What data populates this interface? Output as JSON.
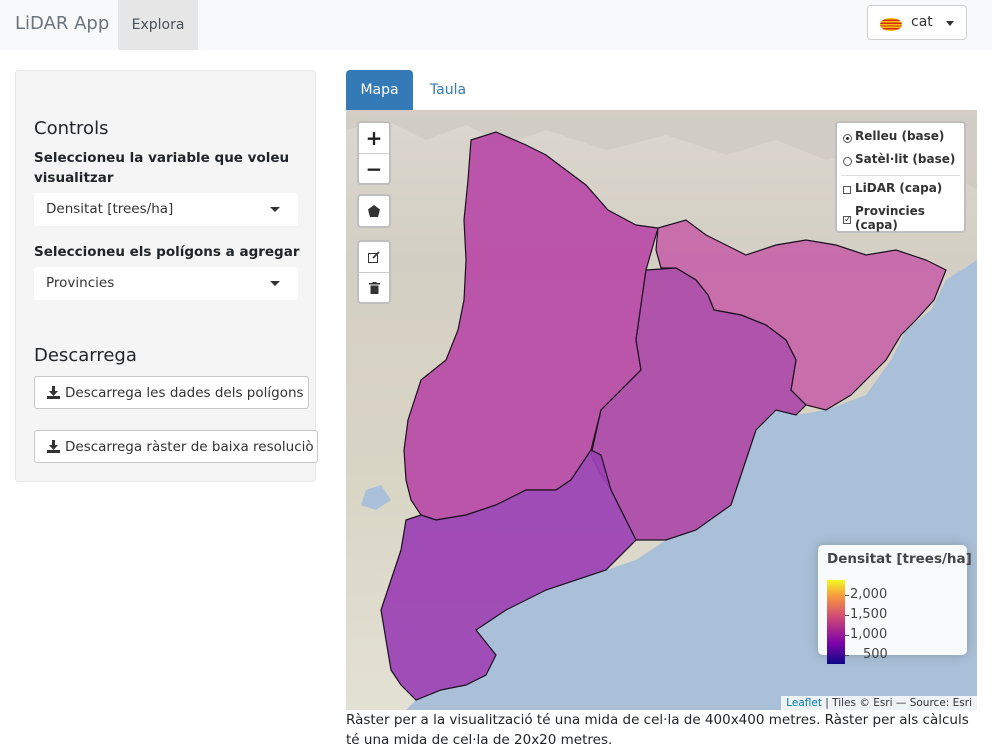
{
  "navbar": {
    "brand": "LiDAR App",
    "tab": "Explora",
    "language": "cat"
  },
  "sidebar": {
    "controls_heading": "Controls",
    "variable_label": "Seleccioneu la variable que voleu visualitzar",
    "variable_value": "Densitat [trees/ha]",
    "polygons_label": "Seleccioneu els polígons a agregar",
    "polygons_value": "Provincies",
    "download_heading": "Descarrega",
    "download_polygons": "Descarrega les dades dels polígons",
    "download_raster": "Descarrega ràster de baixa resoluciò"
  },
  "tabs": [
    "Mapa",
    "Taula"
  ],
  "map": {
    "zoom_in": "+",
    "zoom_out": "−",
    "layers": {
      "base": [
        {
          "label": "Relleu (base)",
          "selected": true
        },
        {
          "label": "Satèl·lit (base)",
          "selected": false
        }
      ],
      "overlays": [
        {
          "label": "LiDAR (capa)",
          "checked": false
        },
        {
          "label": "Provincies (capa)",
          "checked": true
        }
      ]
    },
    "legend": {
      "title": "Densitat [trees/ha]",
      "labels": [
        "2,000",
        "1,500",
        "1,000",
        "500"
      ]
    },
    "attribution": {
      "leaflet": "Leaflet",
      "separator": " | ",
      "tiles": "Tiles © Esri — Source: Esri"
    },
    "colors": {
      "region_north": "#b94aa6",
      "region_northeast": "#c565a8",
      "region_center": "#ab48a8",
      "region_south": "#9b40b4",
      "sea": "#a9c0d8"
    }
  },
  "caption": "Ràster per a la visualització té una mida de cel·la de 400x400 metres. Ràster per als càlculs té una mida de cel·la de 20x20 metres."
}
